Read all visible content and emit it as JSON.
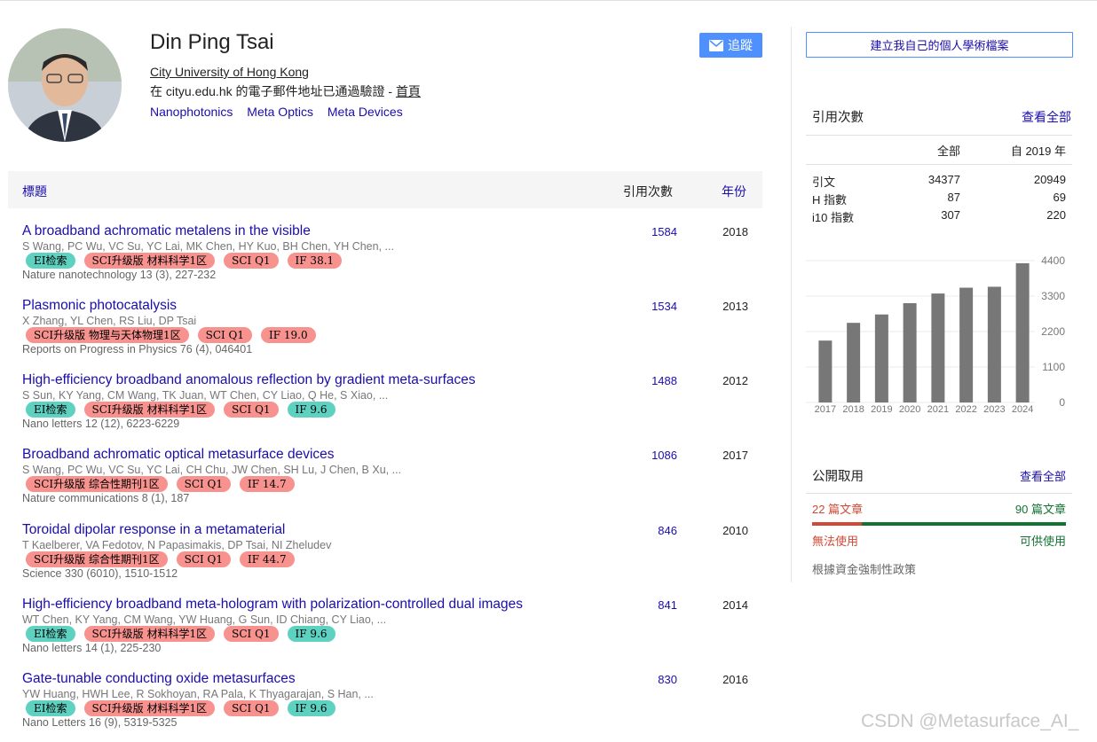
{
  "profile": {
    "name": "Din Ping Tsai",
    "affiliation": "City University of Hong Kong",
    "verified_prefix": "在 cityu.edu.hk 的電子郵件地址已通過驗證 - ",
    "home_link": "首頁",
    "interests": [
      "Nanophotonics",
      "Meta Optics",
      "Meta Devices"
    ],
    "follow_label": "追蹤"
  },
  "table": {
    "header_title": "標題",
    "header_cites": "引用次數",
    "header_year": "年份",
    "rows": [
      {
        "title": "A broadband achromatic metalens in the visible",
        "authors": "S Wang, PC Wu, VC Su, YC Lai, MK Chen, HY Kuo, BH Chen, YH Chen, ...",
        "tags": [
          {
            "text": "EI检索",
            "kind": "ei"
          },
          {
            "text": "SCI升级版 材料科学1区",
            "kind": "red"
          },
          {
            "text": "SCI Q1",
            "kind": "red"
          },
          {
            "text": "IF 38.1",
            "kind": "red"
          }
        ],
        "venue": "Nature nanotechnology 13 (3), 227-232",
        "cites": "1584",
        "year": "2018"
      },
      {
        "title": "Plasmonic photocatalysis",
        "authors": "X Zhang, YL Chen, RS Liu, DP Tsai",
        "tags": [
          {
            "text": "SCI升级版 物理与天体物理1区",
            "kind": "red"
          },
          {
            "text": "SCI Q1",
            "kind": "red"
          },
          {
            "text": "IF 19.0",
            "kind": "red"
          }
        ],
        "venue": "Reports on Progress in Physics 76 (4), 046401",
        "cites": "1534",
        "year": "2013"
      },
      {
        "title": "High-efficiency broadband anomalous reflection by gradient meta-surfaces",
        "authors": "S Sun, KY Yang, CM Wang, TK Juan, WT Chen, CY Liao, Q He, S Xiao, ...",
        "tags": [
          {
            "text": "EI检索",
            "kind": "ei"
          },
          {
            "text": "SCI升级版 材料科学1区",
            "kind": "red"
          },
          {
            "text": "SCI Q1",
            "kind": "red"
          },
          {
            "text": "IF 9.6",
            "kind": "teal"
          }
        ],
        "venue": "Nano letters 12 (12), 6223-6229",
        "cites": "1488",
        "year": "2012"
      },
      {
        "title": "Broadband achromatic optical metasurface devices",
        "authors": "S Wang, PC Wu, VC Su, YC Lai, CH Chu, JW Chen, SH Lu, J Chen, B Xu, ...",
        "tags": [
          {
            "text": "SCI升级版 综合性期刊1区",
            "kind": "red"
          },
          {
            "text": "SCI Q1",
            "kind": "red"
          },
          {
            "text": "IF 14.7",
            "kind": "red"
          }
        ],
        "venue": "Nature communications 8 (1), 187",
        "cites": "1086",
        "year": "2017"
      },
      {
        "title": "Toroidal dipolar response in a metamaterial",
        "authors": "T Kaelberer, VA Fedotov, N Papasimakis, DP Tsai, NI Zheludev",
        "tags": [
          {
            "text": "SCI升级版 综合性期刊1区",
            "kind": "red"
          },
          {
            "text": "SCI Q1",
            "kind": "red"
          },
          {
            "text": "IF 44.7",
            "kind": "red"
          }
        ],
        "venue": "Science 330 (6010), 1510-1512",
        "cites": "846",
        "year": "2010"
      },
      {
        "title": "High-efficiency broadband meta-hologram with polarization-controlled dual images",
        "authors": "WT Chen, KY Yang, CM Wang, YW Huang, G Sun, ID Chiang, CY Liao, ...",
        "tags": [
          {
            "text": "EI检索",
            "kind": "ei"
          },
          {
            "text": "SCI升级版 材料科学1区",
            "kind": "red"
          },
          {
            "text": "SCI Q1",
            "kind": "red"
          },
          {
            "text": "IF 9.6",
            "kind": "teal"
          }
        ],
        "venue": "Nano letters 14 (1), 225-230",
        "cites": "841",
        "year": "2014"
      },
      {
        "title": "Gate-tunable conducting oxide metasurfaces",
        "authors": "YW Huang, HWH Lee, R Sokhoyan, RA Pala, K Thyagarajan, S Han, ...",
        "tags": [
          {
            "text": "EI检索",
            "kind": "ei"
          },
          {
            "text": "SCI升级版 材料科学1区",
            "kind": "red"
          },
          {
            "text": "SCI Q1",
            "kind": "red"
          },
          {
            "text": "IF 9.6",
            "kind": "teal"
          }
        ],
        "venue": "Nano Letters 16 (9), 5319-5325",
        "cites": "830",
        "year": "2016"
      }
    ]
  },
  "sidebar": {
    "create_button": "建立我自己的個人學術檔案",
    "citations_title": "引用次數",
    "see_all": "查看全部",
    "col_all": "全部",
    "col_since": "自 2019 年",
    "stats": [
      {
        "label": "引文",
        "all": "34377",
        "since": "20949"
      },
      {
        "label": "H 指數",
        "all": "87",
        "since": "69"
      },
      {
        "label": "i10 指數",
        "all": "307",
        "since": "220"
      }
    ],
    "access_title": "公開取用",
    "access_see_all": "查看全部",
    "not_available_count": "22 篇文章",
    "available_count": "90 篇文章",
    "not_available_label": "無法使用",
    "available_label": "可供使用",
    "not_available_fraction": 0.196,
    "policy": "根據資金強制性政策"
  },
  "chart_data": {
    "type": "bar",
    "categories": [
      "2017",
      "2018",
      "2019",
      "2020",
      "2021",
      "2022",
      "2023",
      "2024"
    ],
    "values": [
      1920,
      2470,
      2730,
      3080,
      3380,
      3560,
      3590,
      4320
    ],
    "yticks": [
      "4400",
      "3300",
      "2200",
      "1100",
      "0"
    ],
    "ylim": [
      0,
      4400
    ],
    "bar_color": "#777777"
  },
  "watermark": "CSDN @Metasurface_AI_"
}
